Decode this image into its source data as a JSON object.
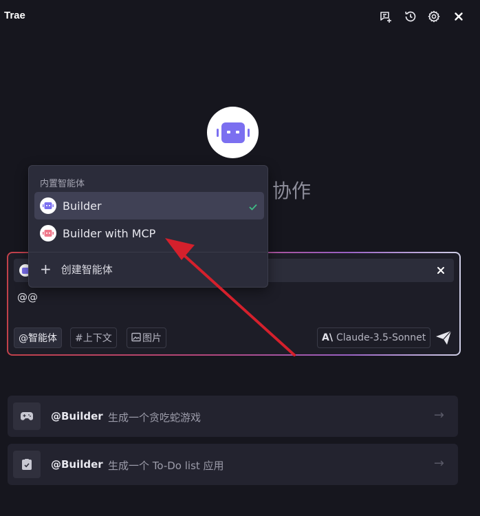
{
  "app": {
    "title": "Trae"
  },
  "hero": {
    "title": "协作"
  },
  "dropdown": {
    "header": "内置智能体",
    "items": [
      {
        "label": "Builder",
        "selected": true
      },
      {
        "label": "Builder with MCP",
        "selected": false
      }
    ],
    "create_label": "创建智能体"
  },
  "chat": {
    "input_text": "@@",
    "tools": {
      "agent": "@智能体",
      "context": "#上下文",
      "image": "图片"
    },
    "model": "Claude-3.5-Sonnet"
  },
  "suggestions": [
    {
      "mention": "@Builder",
      "text": "生成一个贪吃蛇游戏"
    },
    {
      "mention": "@Builder",
      "text": "生成一个 To-Do list 应用"
    }
  ],
  "colors": {
    "accent_purple": "#7b6ff0",
    "check_green": "#3fbf86",
    "annotation_arrow": "#d4202c"
  }
}
